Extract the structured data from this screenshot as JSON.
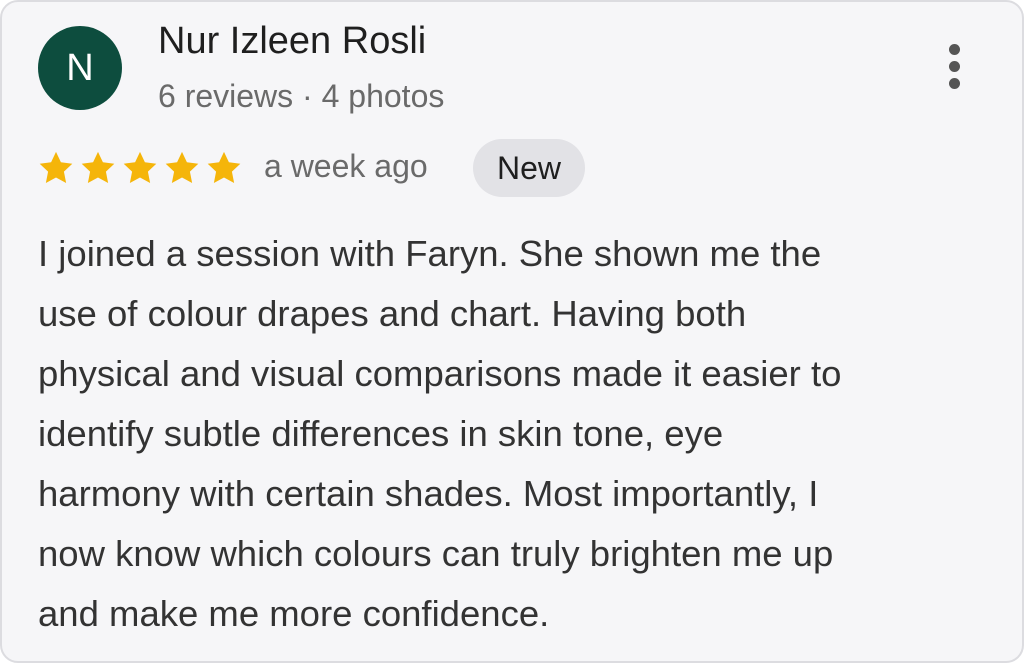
{
  "reviewer": {
    "initial": "N",
    "name": "Nur Izleen Rosli",
    "stats": "6 reviews · 4 photos",
    "avatar_color": "#0d4d3e"
  },
  "rating": {
    "stars": 5,
    "max": 5,
    "color": "#f5b50a"
  },
  "time_ago": "a week ago",
  "badge": "New",
  "review_lines": [
    "I joined a session with Faryn. She shown me the",
    "use of colour drapes and chart. Having both",
    "physical and visual comparisons made it easier to",
    "identify subtle differences in skin tone, eye",
    "harmony with certain shades. Most importantly, I",
    "now know which colours can truly brighten me up",
    "and make me more confidence."
  ],
  "icons": {
    "menu": "more-vert-icon",
    "star": "star-icon"
  }
}
